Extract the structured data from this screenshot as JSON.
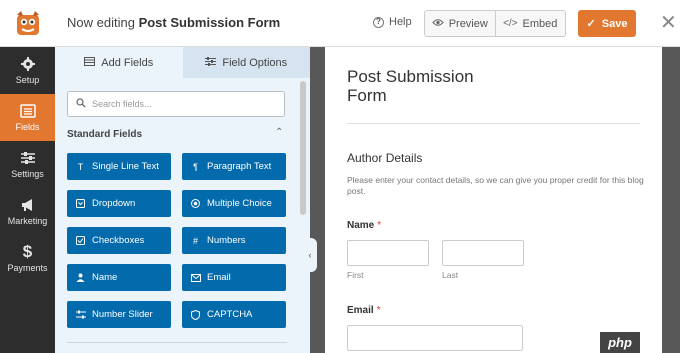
{
  "header": {
    "editing_prefix": "Now editing",
    "form_name": "Post Submission Form",
    "help_label": "Help",
    "preview_label": "Preview",
    "embed_label": "Embed",
    "save_label": "Save",
    "accent_color": "#e27730"
  },
  "sidebar": {
    "items": [
      {
        "label": "Setup",
        "icon": "gear-icon"
      },
      {
        "label": "Fields",
        "icon": "fields-list-icon",
        "active": true
      },
      {
        "label": "Settings",
        "icon": "sliders-icon"
      },
      {
        "label": "Marketing",
        "icon": "megaphone-icon"
      },
      {
        "label": "Payments",
        "icon": "dollar-icon"
      }
    ]
  },
  "panel": {
    "tabs": [
      {
        "label": "Add Fields",
        "icon": "table-icon",
        "active": true
      },
      {
        "label": "Field Options",
        "icon": "sliders-icon",
        "active": false
      }
    ],
    "search_placeholder": "Search fields...",
    "section_title": "Standard Fields",
    "fields": [
      {
        "label": "Single Line Text",
        "icon": "text-icon"
      },
      {
        "label": "Paragraph Text",
        "icon": "paragraph-icon"
      },
      {
        "label": "Dropdown",
        "icon": "dropdown-icon"
      },
      {
        "label": "Multiple Choice",
        "icon": "radio-icon"
      },
      {
        "label": "Checkboxes",
        "icon": "checkbox-icon"
      },
      {
        "label": "Numbers",
        "icon": "hash-icon"
      },
      {
        "label": "Name",
        "icon": "user-icon"
      },
      {
        "label": "Email",
        "icon": "envelope-icon"
      },
      {
        "label": "Number Slider",
        "icon": "slider-icon"
      },
      {
        "label": "CAPTCHA",
        "icon": "captcha-icon"
      }
    ],
    "field_color": "#036aab"
  },
  "form": {
    "title": "Post Submission Form",
    "section_title": "Author Details",
    "section_desc": "Please enter your contact details, so we can give you proper credit for this blog post.",
    "name_label": "Name",
    "required_mark": "*",
    "first_sub": "First",
    "last_sub": "Last",
    "email_label": "Email"
  },
  "watermark": "php"
}
